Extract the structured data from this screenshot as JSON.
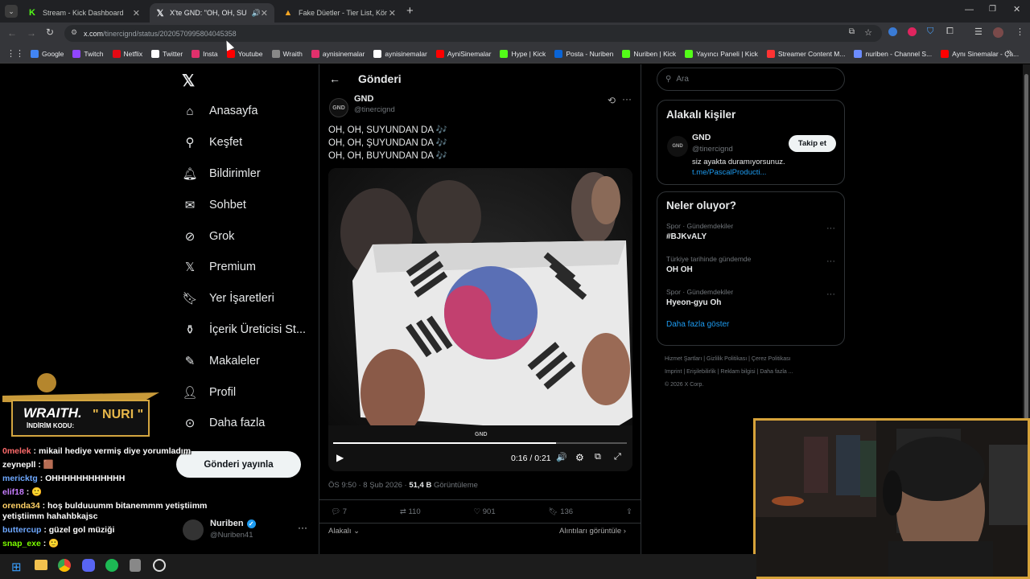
{
  "tabs": [
    {
      "label": "Stream - Kick Dashboard",
      "icon": "kick-icon",
      "color": "#53fc18"
    },
    {
      "label": "X'te GND: \"OH, OH, SUYUN",
      "icon": "x-icon",
      "color": "#fff"
    },
    {
      "label": "Fake Düetler - Tier List, Kör Sıra",
      "icon": "tierlist-icon",
      "color": "#f5a623"
    }
  ],
  "address": {
    "host": "x.com",
    "path": "/tinercignd/status/2020570995804045358"
  },
  "bookmarks": [
    {
      "label": "Google",
      "color": "#4285f4"
    },
    {
      "label": "Twitch",
      "color": "#9146ff"
    },
    {
      "label": "Netflix",
      "color": "#e50914"
    },
    {
      "label": "Twitter",
      "color": "#ffffff"
    },
    {
      "label": "Insta",
      "color": "#e1306c"
    },
    {
      "label": "Youtube",
      "color": "#ff0000"
    },
    {
      "label": "Wraith",
      "color": "#888888"
    },
    {
      "label": "aynisinemalar",
      "color": "#e1306c"
    },
    {
      "label": "aynisinemalar",
      "color": "#ffffff"
    },
    {
      "label": "AyniSinemalar",
      "color": "#ff0000"
    },
    {
      "label": "Hype | Kick",
      "color": "#53fc18"
    },
    {
      "label": "Posta - Nuriben",
      "color": "#0a64d6"
    },
    {
      "label": "Nuriben | Kick",
      "color": "#53fc18"
    },
    {
      "label": "Yayıncı Paneli | Kick",
      "color": "#53fc18"
    },
    {
      "label": "Streamer Content M...",
      "color": "#ff3333"
    },
    {
      "label": "nuriben - Channel S...",
      "color": "#6c8cff"
    },
    {
      "label": "Aynı Sinemalar - Ça...",
      "color": "#ff0000"
    }
  ],
  "nav": [
    {
      "label": "Anasayfa",
      "icon": "home-icon"
    },
    {
      "label": "Keşfet",
      "icon": "search-icon"
    },
    {
      "label": "Bildirimler",
      "icon": "bell-icon"
    },
    {
      "label": "Sohbet",
      "icon": "mail-icon"
    },
    {
      "label": "Grok",
      "icon": "grok-icon"
    },
    {
      "label": "Premium",
      "icon": "x-icon"
    },
    {
      "label": "Yer İşaretleri",
      "icon": "bookmark-icon"
    },
    {
      "label": "İçerik Üreticisi St...",
      "icon": "creator-icon"
    },
    {
      "label": "Makaleler",
      "icon": "article-icon"
    },
    {
      "label": "Profil",
      "icon": "person-icon"
    },
    {
      "label": "Daha fazla",
      "icon": "more-circle-icon"
    }
  ],
  "post_button": "Gönderi yayınla",
  "account": {
    "name": "Nuriben",
    "handle": "@Nuriben41"
  },
  "main": {
    "header": "Gönderi",
    "author": {
      "name": "GND",
      "handle": "@tinercignd",
      "avatar": "GND"
    },
    "lines": [
      "OH, OH, SUYUNDAN DA 🎶",
      "OH, OH, ŞUYUNDAN DA 🎶",
      "OH, OH, BUYUNDAN DA 🎶"
    ],
    "video": {
      "time": "0:16 / 0:21",
      "progress": 0.76,
      "watermark": "GND"
    },
    "meta": {
      "time": "ÖS 9:50 · 8 Şub 2026 · ",
      "views": "51,4 B",
      "views_label": " Görüntüleme"
    },
    "stats": {
      "replies": "7",
      "reposts": "110",
      "likes": "901",
      "bookmarks": "136"
    },
    "filter": "Alakalı",
    "quotes": "Alıntıları görüntüle"
  },
  "right": {
    "search_placeholder": "Ara",
    "relevant_title": "Alakalı kişiler",
    "person": {
      "name": "GND",
      "handle": "@tinercignd",
      "bio": "siz ayakta duramıyorsunuz.",
      "link": "t.me/PascalProducti...",
      "follow": "Takip et"
    },
    "trends_title": "Neler oluyor?",
    "trends": [
      {
        "cat": "Spor · Gündemdekiler",
        "name": "#BJKvALY"
      },
      {
        "cat": "Türkiye tarihinde gündemde",
        "name": "OH OH"
      },
      {
        "cat": "Spor · Gündemdekiler",
        "name": "Hyeon-gyu Oh"
      }
    ],
    "show_more": "Daha fazla göster",
    "footer": [
      "Hizmet Şartları",
      "Gizlilik Politikası",
      "Çerez Politikası",
      "Imprint",
      "Erişilebilirlik",
      "Reklam bilgisi",
      "Daha fazla ...",
      "© 2026 X Corp."
    ]
  },
  "overlay": {
    "brand": "WRAITH.",
    "code_label": "İNDİRİM KODU:",
    "code": "NURI"
  },
  "chat": [
    {
      "user": "0melek",
      "color": "#ff6b6b",
      "msg": ": mikail hediye vermiş diye yorumladım"
    },
    {
      "user": "zeynepll",
      "color": "#ffffff",
      "msg": ": 🟫"
    },
    {
      "user": "mericktg",
      "color": "#6ea8ff",
      "msg": ": OHHHHHHHHHHHH"
    },
    {
      "user": "elif18",
      "color": "#c77dff",
      "msg": ": 🙂"
    },
    {
      "user": "orenda34",
      "color": "#ffd166",
      "msg": ": hoş bulduuumm bitanemmm yetiştiimm yetiştiimm hahahbkajsc"
    },
    {
      "user": "buttercup",
      "color": "#6ea8ff",
      "msg": ": güzel gol müziği"
    },
    {
      "user": "snap_exe",
      "color": "#7CFC00",
      "msg": ": 🙂"
    }
  ]
}
